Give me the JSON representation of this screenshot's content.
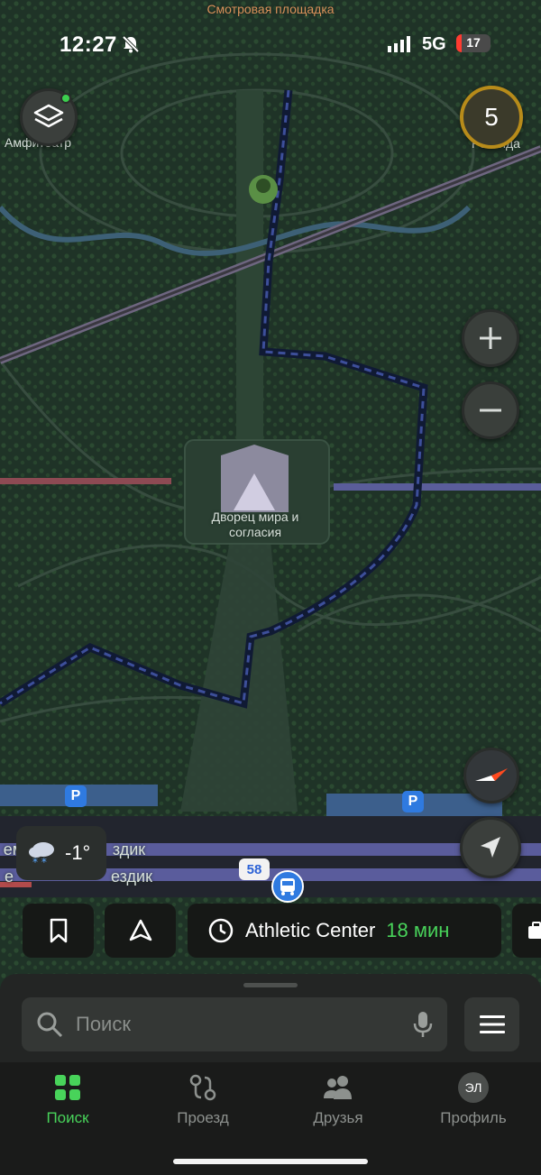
{
  "status": {
    "time": "12:27",
    "network": "5G",
    "battery": "17",
    "battery_level": 0.17
  },
  "map": {
    "labels": {
      "top": "Смотровая площадка",
      "amphitheater": "Амфитеатр",
      "rotunda": "Ротонда",
      "palace_line1": "Дворец мира и",
      "palace_line2": "согласия",
      "street1": "ем",
      "street1b": "здик",
      "street2": "е",
      "street2b": "ездик"
    },
    "counter": "5",
    "route_number": "58",
    "parking": "P"
  },
  "weather": {
    "temp": "-1°",
    "icon": "snow-cloud-icon"
  },
  "quick_actions": {
    "destination": "Athletic Center",
    "eta": "18 мин"
  },
  "search": {
    "placeholder": "Поиск"
  },
  "tabs": [
    {
      "label": "Поиск",
      "icon": "grid-icon",
      "active": true
    },
    {
      "label": "Проезд",
      "icon": "transit-icon",
      "active": false
    },
    {
      "label": "Друзья",
      "icon": "friends-icon",
      "active": false
    },
    {
      "label": "Профиль",
      "icon": "avatar",
      "initials": "ЭЛ",
      "active": false
    }
  ],
  "colors": {
    "accent": "#48d35a",
    "map_bg": "#1f3226",
    "route": "#2b3a70",
    "parking": "#2f7ae0",
    "counter_ring": "#b78b1a"
  }
}
